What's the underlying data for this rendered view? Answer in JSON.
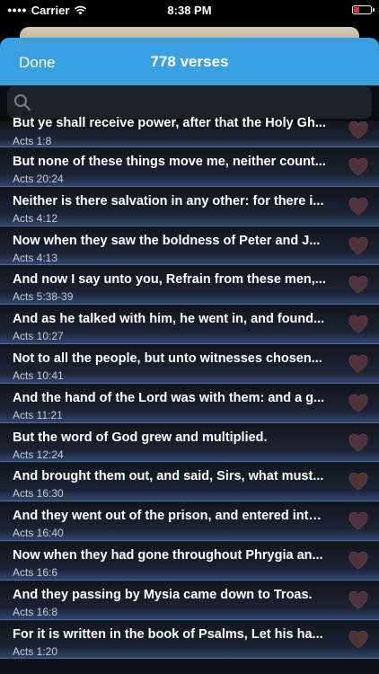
{
  "status_bar": {
    "carrier": "Carrier",
    "time": "8:38 PM"
  },
  "nav": {
    "done_label": "Done",
    "title": "778 verses"
  },
  "search": {
    "placeholder": ""
  },
  "verses": [
    {
      "text": "But ye shall receive power, after that the Holy Gh...",
      "ref": "Acts 1:8"
    },
    {
      "text": "But none of these things move me, neither count...",
      "ref": "Acts 20:24"
    },
    {
      "text": "Neither is there salvation in any other: for there i...",
      "ref": "Acts 4:12"
    },
    {
      "text": "Now when they saw the boldness of Peter and J...",
      "ref": "Acts 4:13"
    },
    {
      "text": "And now I say unto you, Refrain from these men,...",
      "ref": "Acts 5:38-39"
    },
    {
      "text": "And as he talked with him, he went in, and found...",
      "ref": "Acts 10:27"
    },
    {
      "text": "Not to all the people, but unto witnesses chosen...",
      "ref": "Acts 10:41"
    },
    {
      "text": "And the hand of the Lord was with them: and a g...",
      "ref": "Acts 11:21"
    },
    {
      "text": "But the word of God grew and multiplied.",
      "ref": "Acts 12:24"
    },
    {
      "text": "And brought them out, and said, Sirs, what must...",
      "ref": "Acts 16:30"
    },
    {
      "text": "And they went out of the prison, and entered into...",
      "ref": "Acts 16:40"
    },
    {
      "text": "Now when they had gone throughout Phrygia an...",
      "ref": "Acts 16:6"
    },
    {
      "text": "And they passing by Mysia came down to Troas.",
      "ref": "Acts 16:8"
    },
    {
      "text": "For it is written in the book of Psalms, Let his ha...",
      "ref": "Acts 1:20"
    }
  ],
  "colors": {
    "nav": "#3aa0e2",
    "heart": "#5a3a3f",
    "row_border": "#4d6ea3"
  }
}
